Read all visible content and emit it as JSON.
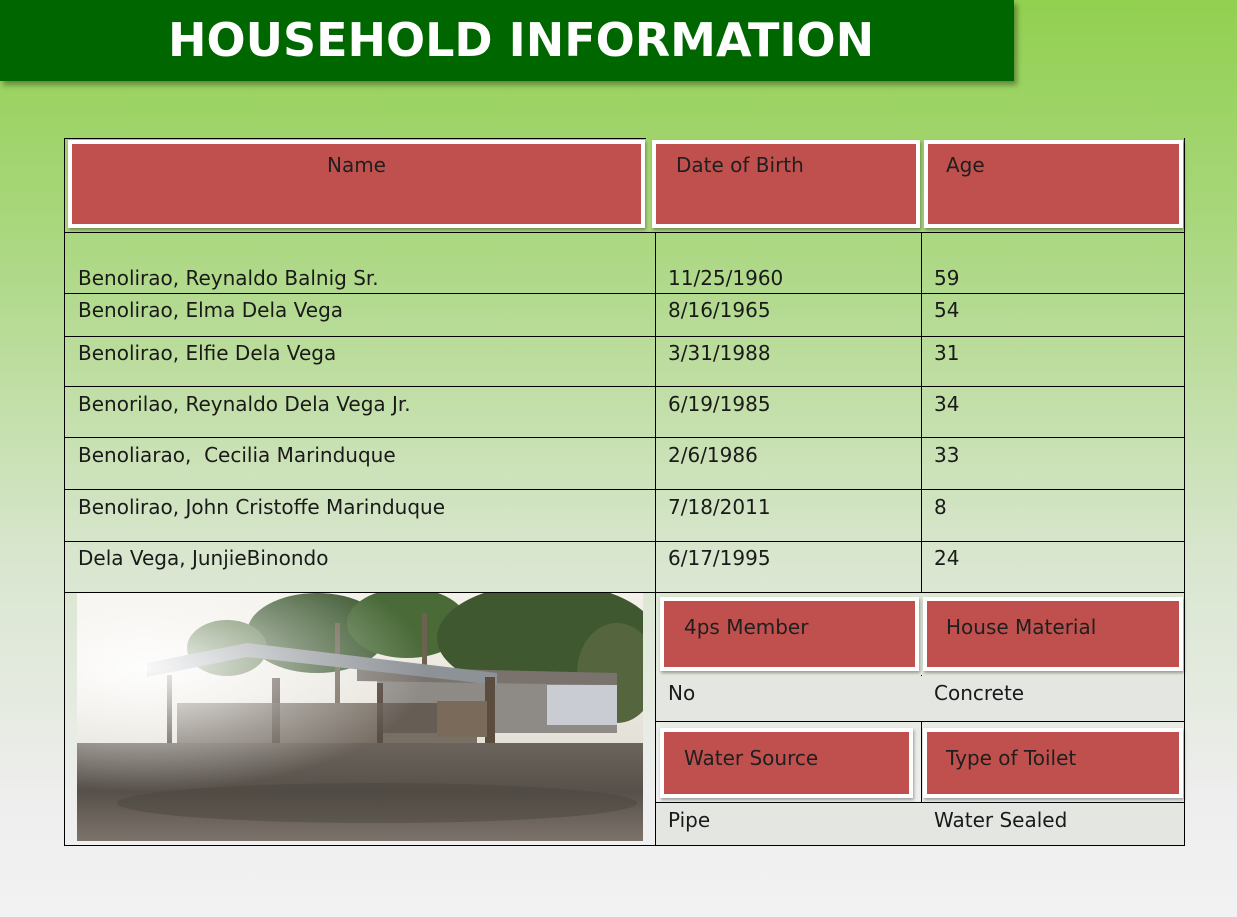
{
  "title": "HOUSEHOLD INFORMATION",
  "members_table": {
    "headers": {
      "name": "Name",
      "dob": "Date of Birth",
      "age": "Age"
    },
    "rows": [
      {
        "name": "Benolirao, Reynaldo Balnig Sr.",
        "dob": "11/25/1960",
        "age": "59"
      },
      {
        "name": "Benolirao, Elma Dela Vega",
        "dob": "8/16/1965",
        "age": "54"
      },
      {
        "name": "Benolirao, Elfie Dela Vega",
        "dob": "3/31/1988",
        "age": "31"
      },
      {
        "name": "Benorilao, Reynaldo Dela Vega Jr.",
        "dob": "6/19/1985",
        "age": "34"
      },
      {
        "name": "Benoliarao,  Cecilia Marinduque",
        "dob": "2/6/1986",
        "age": "33"
      },
      {
        "name": "Benolirao, John Cristoffe Marinduque",
        "dob": "7/18/2011",
        "age": "8"
      },
      {
        "name": "Dela Vega, JunjieBinondo",
        "dob": "6/17/1995",
        "age": "24"
      }
    ]
  },
  "household_details": {
    "fourps_member": {
      "label": "4ps Member",
      "value": "No"
    },
    "house_material": {
      "label": "House Material",
      "value": "Concrete"
    },
    "water_source": {
      "label": "Water Source",
      "value": "Pipe"
    },
    "toilet_type": {
      "label": "Type of Toilet",
      "value": "Water Sealed"
    }
  },
  "colors": {
    "title_bar": "#006600",
    "header_cell": "#c0504d",
    "background_top": "#92d050",
    "background_bottom": "#f2f2f2"
  }
}
